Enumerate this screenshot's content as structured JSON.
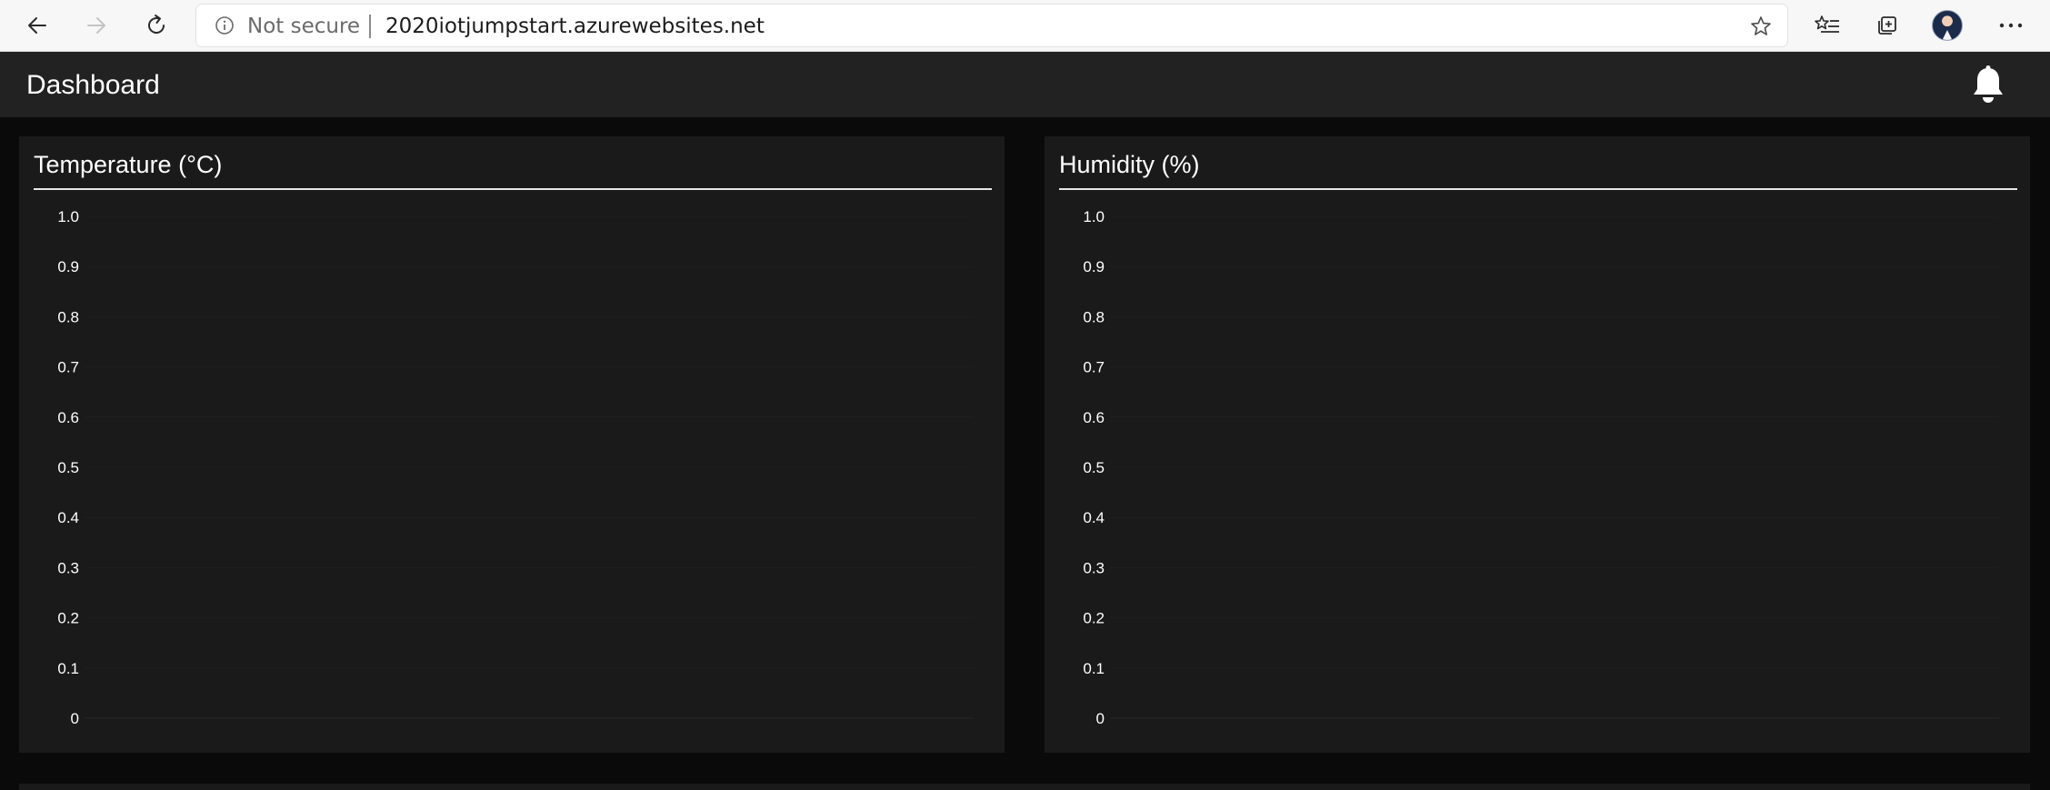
{
  "browser": {
    "security_label": "Not secure",
    "url": "2020iotjumpstart.azurewebsites.net"
  },
  "icons": {
    "back": "back-arrow-icon",
    "forward": "forward-arrow-icon",
    "refresh": "refresh-icon",
    "info": "info-icon",
    "favorite": "star-icon",
    "favorites_list": "favorites-icon",
    "collections": "collections-icon",
    "more": "more-icon",
    "notifications": "bell-icon"
  },
  "header": {
    "title": "Dashboard"
  },
  "colors": {
    "page_bg": "#0a0a0a",
    "header_bg": "#222222",
    "panel_bg": "#1a1a1a",
    "text": "#ffffff"
  },
  "chart_data": [
    {
      "type": "line",
      "title": "Temperature (°C)",
      "ylim": [
        0,
        1
      ],
      "yticks": [
        "1.0",
        "0.9",
        "0.8",
        "0.7",
        "0.6",
        "0.5",
        "0.4",
        "0.3",
        "0.2",
        "0.1",
        "0"
      ],
      "series": [],
      "grid": true
    },
    {
      "type": "line",
      "title": "Humidity (%)",
      "ylim": [
        0,
        1
      ],
      "yticks": [
        "1.0",
        "0.9",
        "0.8",
        "0.7",
        "0.6",
        "0.5",
        "0.4",
        "0.3",
        "0.2",
        "0.1",
        "0"
      ],
      "series": [],
      "grid": true
    }
  ]
}
